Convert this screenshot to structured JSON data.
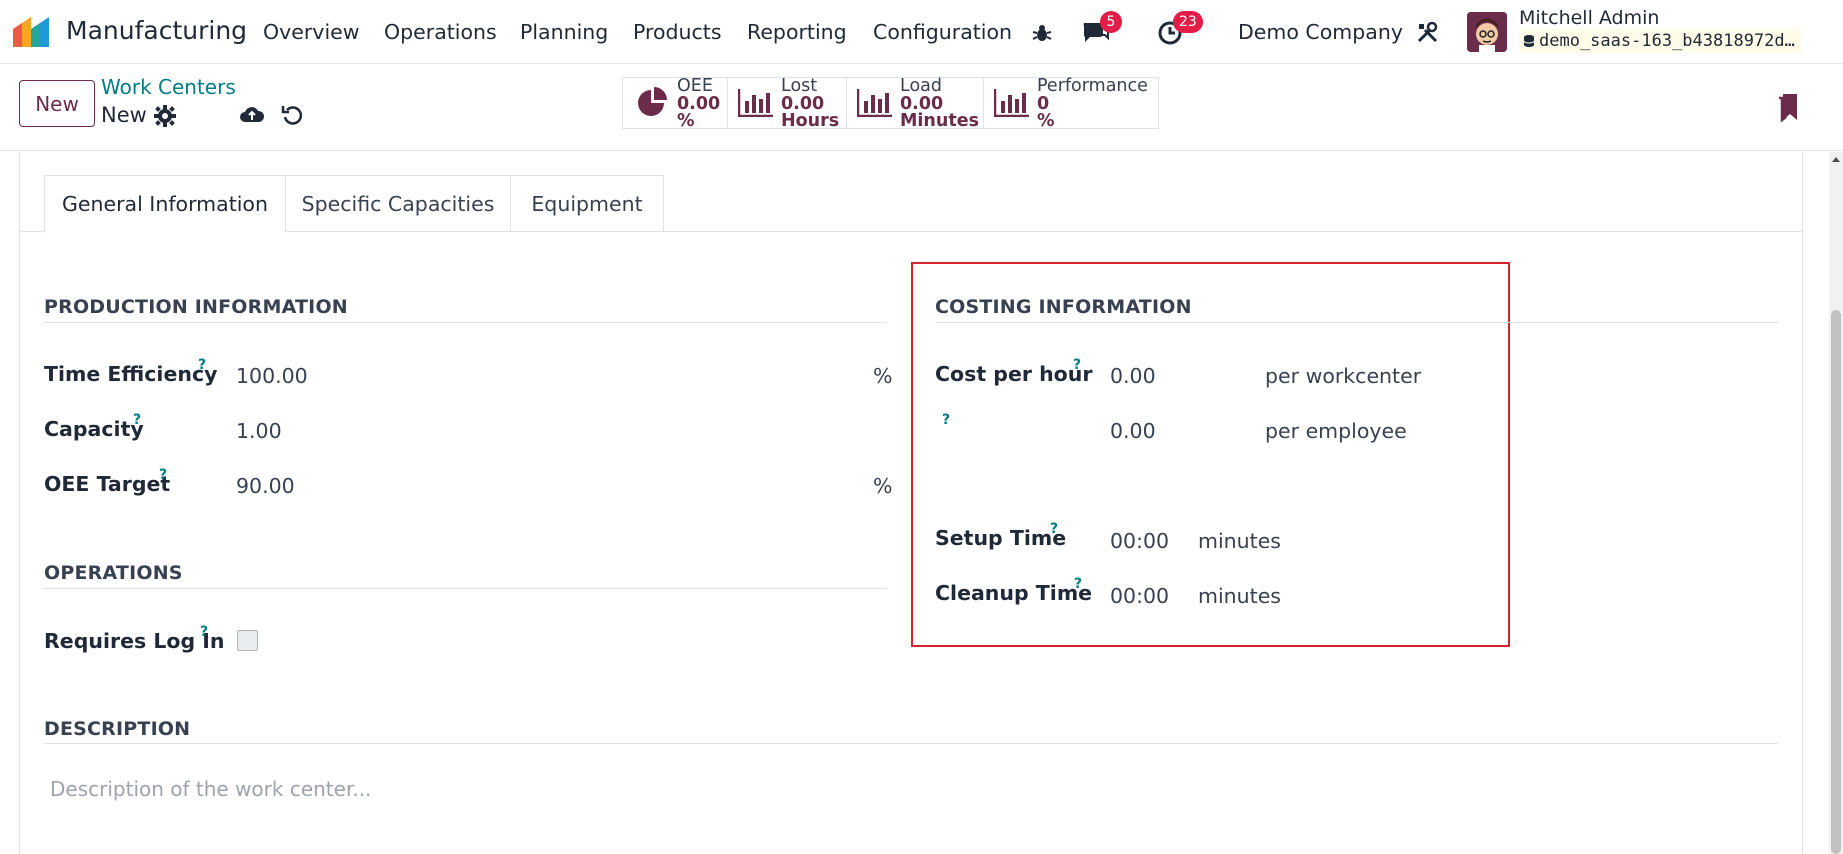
{
  "app": {
    "name": "Manufacturing"
  },
  "menu": [
    "Overview",
    "Operations",
    "Planning",
    "Products",
    "Reporting",
    "Configuration"
  ],
  "systray": {
    "chat_count": "5",
    "activity_count": "23",
    "company": "Demo Company"
  },
  "user": {
    "name": "Mitchell Admin",
    "database": "demo_saas-163_b43818972d…"
  },
  "control_panel": {
    "new_label": "New",
    "breadcrumb_parent": "Work Centers",
    "breadcrumb_current": "New"
  },
  "stats": [
    {
      "label": "OEE",
      "value": "0.00",
      "unit": "%"
    },
    {
      "label": "Lost",
      "value": "0.00",
      "unit": "Hours"
    },
    {
      "label": "Load",
      "value": "0.00",
      "unit": "Minutes"
    },
    {
      "label": "Performance",
      "value": "0",
      "unit": "%"
    }
  ],
  "tabs": [
    "General Information",
    "Specific Capacities",
    "Equipment"
  ],
  "production": {
    "title": "PRODUCTION INFORMATION",
    "time_efficiency": {
      "label": "Time Efficiency",
      "value": "100.00",
      "unit": "%"
    },
    "capacity": {
      "label": "Capacity",
      "value": "1.00"
    },
    "oee_target": {
      "label": "OEE Target",
      "value": "90.00",
      "unit": "%"
    }
  },
  "operations": {
    "title": "OPERATIONS",
    "requires_login": {
      "label": "Requires Log In",
      "checked": false
    }
  },
  "costing": {
    "title": "COSTING INFORMATION",
    "cost_per_hour": {
      "label": "Cost per hour",
      "value": "0.00",
      "unit": "per workcenter"
    },
    "employee_cost": {
      "value": "0.00",
      "unit": "per employee"
    },
    "setup_time": {
      "label": "Setup Time",
      "value": "00:00",
      "unit": "minutes"
    },
    "cleanup_time": {
      "label": "Cleanup Time",
      "value": "00:00",
      "unit": "minutes"
    }
  },
  "description": {
    "title": "DESCRIPTION",
    "placeholder": "Description of the work center..."
  },
  "help_mark": "?",
  "colors": {
    "brand": "#6b2b4b",
    "link": "#017e84",
    "badge": "#e11d48",
    "highlight": "#d1242f"
  }
}
